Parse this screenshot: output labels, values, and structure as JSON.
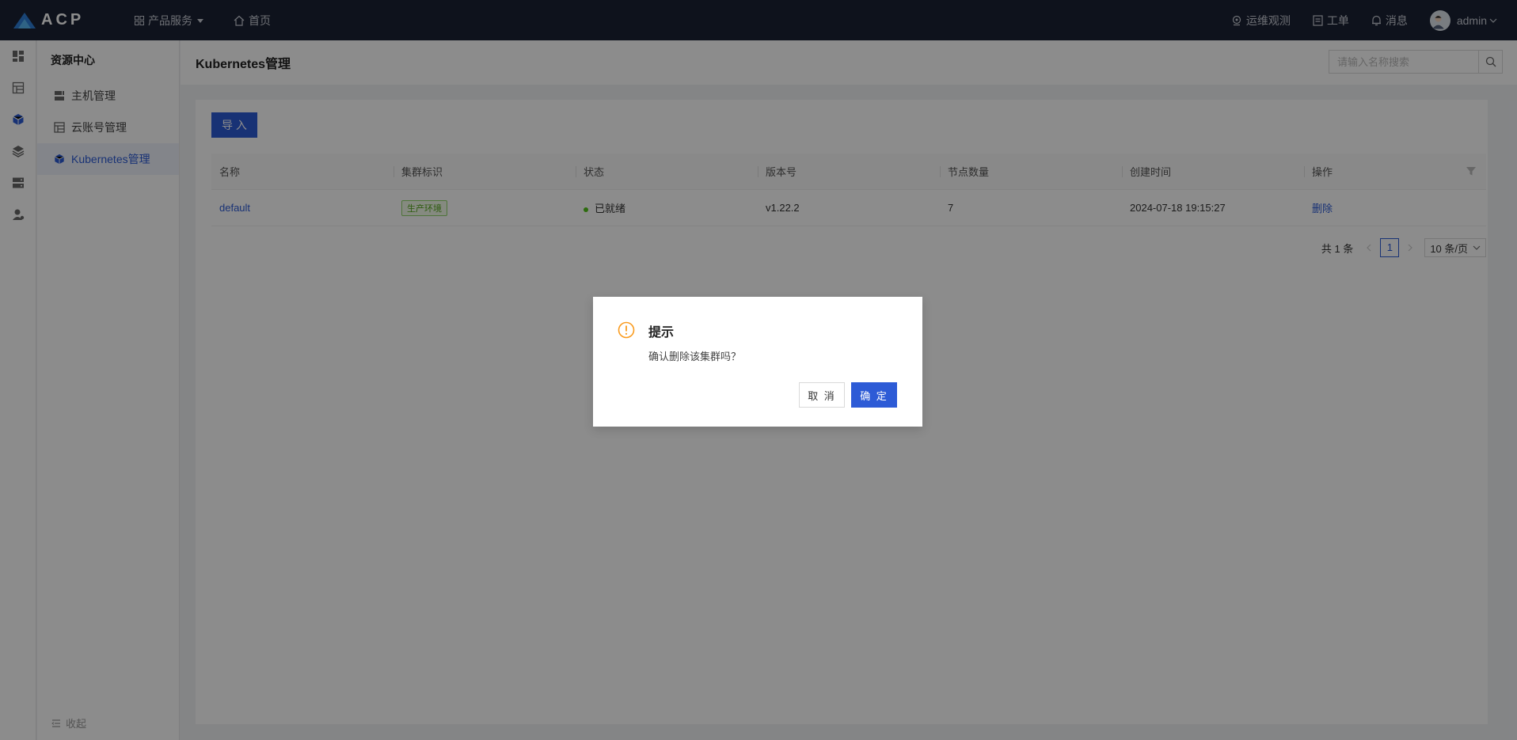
{
  "brand": {
    "logo_text": "ACP",
    "accent": "#2d5bd6"
  },
  "top_nav": {
    "products": "产品服务",
    "home": "首页"
  },
  "top_right": {
    "ops": "运维观测",
    "tickets": "工单",
    "messages": "消息",
    "user": "admin"
  },
  "rail_icons": [
    "dashboard-icon",
    "table-icon",
    "cube-icon",
    "layers-icon",
    "server-icon",
    "user-icon"
  ],
  "sidebar": {
    "title": "资源中心",
    "items": [
      {
        "label": "主机管理",
        "icon": "host-icon"
      },
      {
        "label": "云账号管理",
        "icon": "cloud-account-icon"
      },
      {
        "label": "Kubernetes管理",
        "icon": "cube-icon",
        "active": true
      }
    ],
    "collapse": "收起"
  },
  "page": {
    "title": "Kubernetes管理",
    "search_placeholder": "请输入名称搜索"
  },
  "toolbar": {
    "import_label": "导 入"
  },
  "table": {
    "columns": [
      "名称",
      "集群标识",
      "状态",
      "版本号",
      "节点数量",
      "创建时间",
      "操作"
    ],
    "rows": [
      {
        "name": "default",
        "tag": "生产环境",
        "status": "已就绪",
        "version": "v1.22.2",
        "nodes": "7",
        "created": "2024-07-18 19:15:27",
        "action": "删除"
      }
    ]
  },
  "pagination": {
    "total": "共 1 条",
    "current": "1",
    "page_size": "10 条/页"
  },
  "modal": {
    "title": "提示",
    "message": "确认删除该集群吗？",
    "cancel": "取 消",
    "ok": "确 定"
  }
}
